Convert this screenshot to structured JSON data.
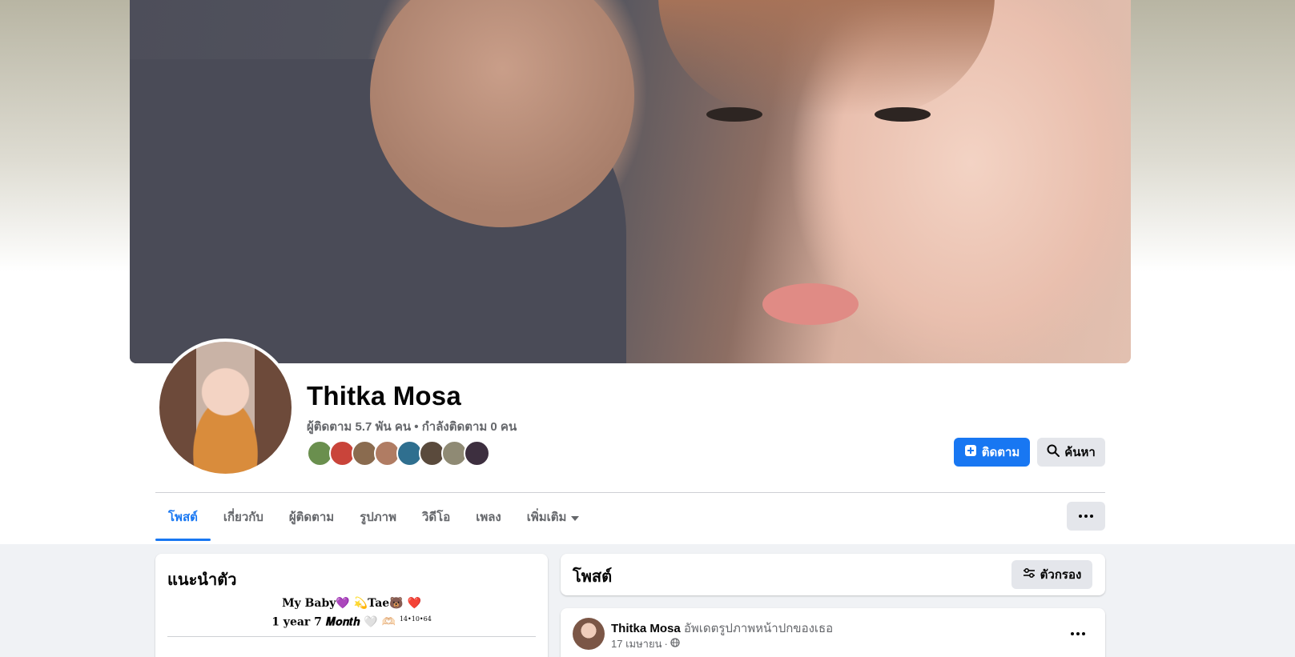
{
  "profile": {
    "name": "Thitka Mosa",
    "stats": "ผู้ติดตาม 5.7 พัน คน • กำลังติดตาม 0 คน",
    "follower_avatar_colors": [
      "#6a8f4e",
      "#c9443a",
      "#8a6b4f",
      "#b07c63",
      "#2f6f8f",
      "#5a4a3c",
      "#8f8a74",
      "#3d2f3f"
    ]
  },
  "actions": {
    "follow_label": "ติดตาม",
    "search_label": "ค้นหา"
  },
  "tabs": [
    {
      "label": "โพสต์",
      "active": true
    },
    {
      "label": "เกี่ยวกับ"
    },
    {
      "label": "ผู้ติดตาม"
    },
    {
      "label": "รูปภาพ"
    },
    {
      "label": "วิดีโอ"
    },
    {
      "label": "เพลง"
    },
    {
      "label": "เพิ่มเติม"
    }
  ],
  "intro": {
    "title": "แนะนำตัว",
    "bio_line1": "My Baby💜 💫Tae🐻 ❤️",
    "bio_line2": "1 year 7 𝑴𝒐𝒏𝒕𝒉 🤍 🫶🏻",
    "bio_date": "14•10•64"
  },
  "posts": {
    "title": "โพสต์",
    "filter_label": "ตัวกรอง"
  },
  "post": {
    "author": "Thitka Mosa",
    "action": "อัพเดตรูปภาพหน้าปกของเธอ",
    "date": "17 เมษายน",
    "separator": "·",
    "privacy_icon": "globe-icon"
  },
  "colors": {
    "accent": "#1877f2",
    "secondary_button": "#e4e6eb",
    "page_bg": "#f0f2f5"
  }
}
